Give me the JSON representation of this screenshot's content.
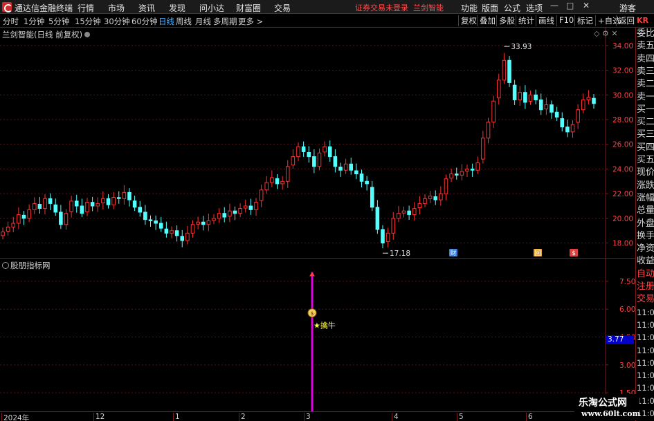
{
  "menubar": {
    "app_title": "通达信金融终端",
    "menus": [
      "行情",
      "市场",
      "资讯",
      "发现",
      "问小达",
      "财富圈",
      "交易"
    ],
    "broker_status": "证券交易未登录",
    "strategy": "兰剑智能",
    "right_menus": [
      "功能",
      "版面",
      "公式",
      "选项"
    ],
    "guest": "游客",
    "win_minimize": "—",
    "win_restore": "□",
    "win_close": "✕"
  },
  "toolbar": {
    "periods": [
      "分时",
      "1分钟",
      "5分钟",
      "15分钟",
      "30分钟",
      "60分钟",
      "日线",
      "周线",
      "月线",
      "多周期",
      "更多 >"
    ],
    "active_period": "日线",
    "buttons": [
      "复权",
      "叠加",
      "多股",
      "统计",
      "画线",
      "F10",
      "标记",
      "+自选",
      "返回"
    ],
    "badge": "KR"
  },
  "main_chart": {
    "title": "兰剑智能(日线 前复权)",
    "header_icons": "◇ ⚙ ✕",
    "high_label": "33.93",
    "low_label": "17.18",
    "markers": [
      "财",
      "回",
      "$"
    ],
    "marker_colors": {
      "财": "#3a7bd5",
      "回": "#e8a83a",
      "$": "#e04040"
    },
    "up_color": "#ff3232",
    "down_color": "#54ffff"
  },
  "sub_chart": {
    "title": "股朋指标网",
    "signal_label": "★擒牛",
    "current_value": "3.77",
    "signal_color": "#e000e0",
    "icon": "money-bag-icon"
  },
  "quote_panel": {
    "items": [
      "委比",
      "卖五",
      "卖四",
      "卖三",
      "卖二",
      "卖一",
      "买一",
      "买二",
      "买三",
      "买四",
      "买五",
      "现价",
      "涨跌",
      "涨幅",
      "总量",
      "外盘",
      "换手",
      "净资",
      "收益",
      "自动",
      "注册",
      "交易",
      "11:0",
      "11:03",
      "11:03",
      "11:04",
      "11:04",
      "11:04",
      "11:05",
      "11:05",
      "11:05"
    ]
  },
  "x_axis": {
    "labels": [
      "2024年",
      "12",
      "1",
      "2",
      "3",
      "4",
      "5",
      "6"
    ]
  },
  "watermark": {
    "title": "乐淘公式网",
    "url": "www.60lt.com"
  },
  "chart_data": [
    {
      "type": "candlestick",
      "title": "兰剑智能(日线 前复权)",
      "y_ticks": [
        "34.00",
        "32.00",
        "30.00",
        "28.00",
        "26.00",
        "24.00",
        "22.00",
        "20.00",
        "18.00"
      ],
      "ylim": [
        16.8,
        35.0
      ],
      "annotations": [
        {
          "text": "33.93",
          "type": "high"
        },
        {
          "text": "17.18",
          "type": "low"
        }
      ],
      "close": [
        18.9,
        19.3,
        19.6,
        20.3,
        20.0,
        20.7,
        21.2,
        20.8,
        21.6,
        21.2,
        20.5,
        19.5,
        20.4,
        21.4,
        21.0,
        20.4,
        21.3,
        21.0,
        21.2,
        21.6,
        21.1,
        21.7,
        21.6,
        22.1,
        21.5,
        20.9,
        20.5,
        19.9,
        19.8,
        19.6,
        19.2,
        18.8,
        19.0,
        18.6,
        18.2,
        18.8,
        19.5,
        19.7,
        19.5,
        19.8,
        20.0,
        20.4,
        20.1,
        20.6,
        20.4,
        20.8,
        21.0,
        20.7,
        21.3,
        22.3,
        22.9,
        23.3,
        22.8,
        23.0,
        24.2,
        25.0,
        25.8,
        25.4,
        25.0,
        24.2,
        25.3,
        25.8,
        25.0,
        24.2,
        23.9,
        24.4,
        23.9,
        23.6,
        23.0,
        22.8,
        20.9,
        19.1,
        18.0,
        18.8,
        20.0,
        20.4,
        20.6,
        20.3,
        20.8,
        21.2,
        21.6,
        21.8,
        21.5,
        22.0,
        23.2,
        23.6,
        23.5,
        23.8,
        24.0,
        23.9,
        24.5,
        26.5,
        27.8,
        29.5,
        31.2,
        32.8,
        31.0,
        29.6,
        30.2,
        29.4,
        30.0,
        29.6,
        28.8,
        29.2,
        28.6,
        28.2,
        27.4,
        27.0,
        27.6,
        28.8,
        29.6,
        29.8,
        29.3
      ],
      "high_value": 33.93,
      "low_value": 17.18
    },
    {
      "type": "bar",
      "title": "股朋指标网",
      "y_ticks": [
        "7.50",
        "6.00",
        "4.50",
        "3.00",
        "1.50"
      ],
      "ylim": [
        0.5,
        8.5
      ],
      "signal": {
        "value": 8.0,
        "label": "★擒牛",
        "marker_value": 5.8
      },
      "current_value": 3.77
    }
  ]
}
